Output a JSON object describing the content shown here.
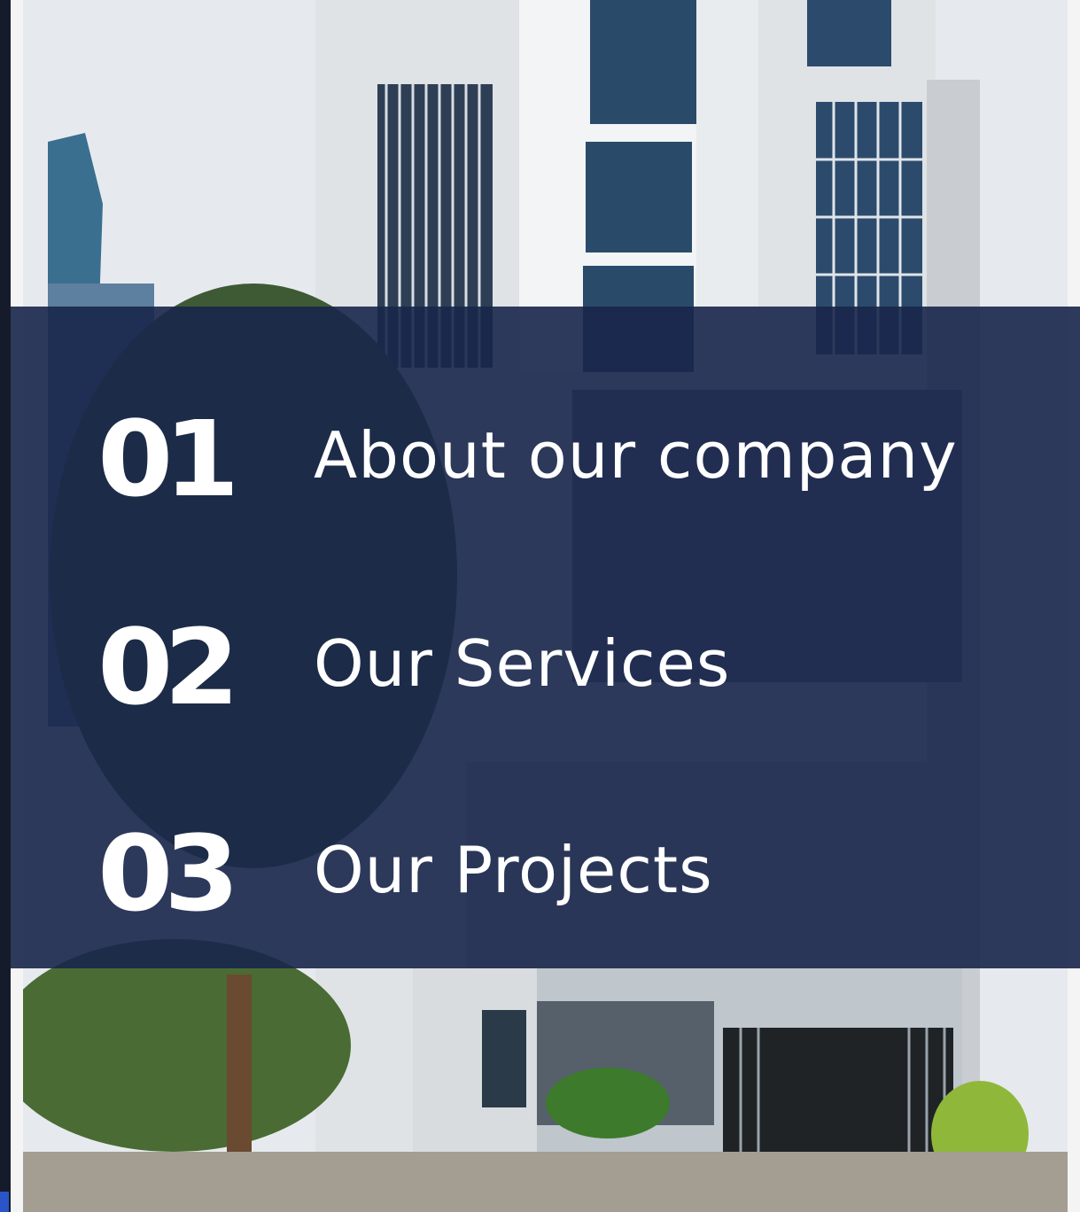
{
  "agenda": {
    "items": [
      {
        "number": "01",
        "label": "About our company"
      },
      {
        "number": "02",
        "label": "Our Services"
      },
      {
        "number": "03",
        "label": "Our Projects"
      }
    ]
  },
  "colors": {
    "overlay": "#18264a",
    "text": "#ffffff",
    "accent_strip": "#2a55c8"
  }
}
